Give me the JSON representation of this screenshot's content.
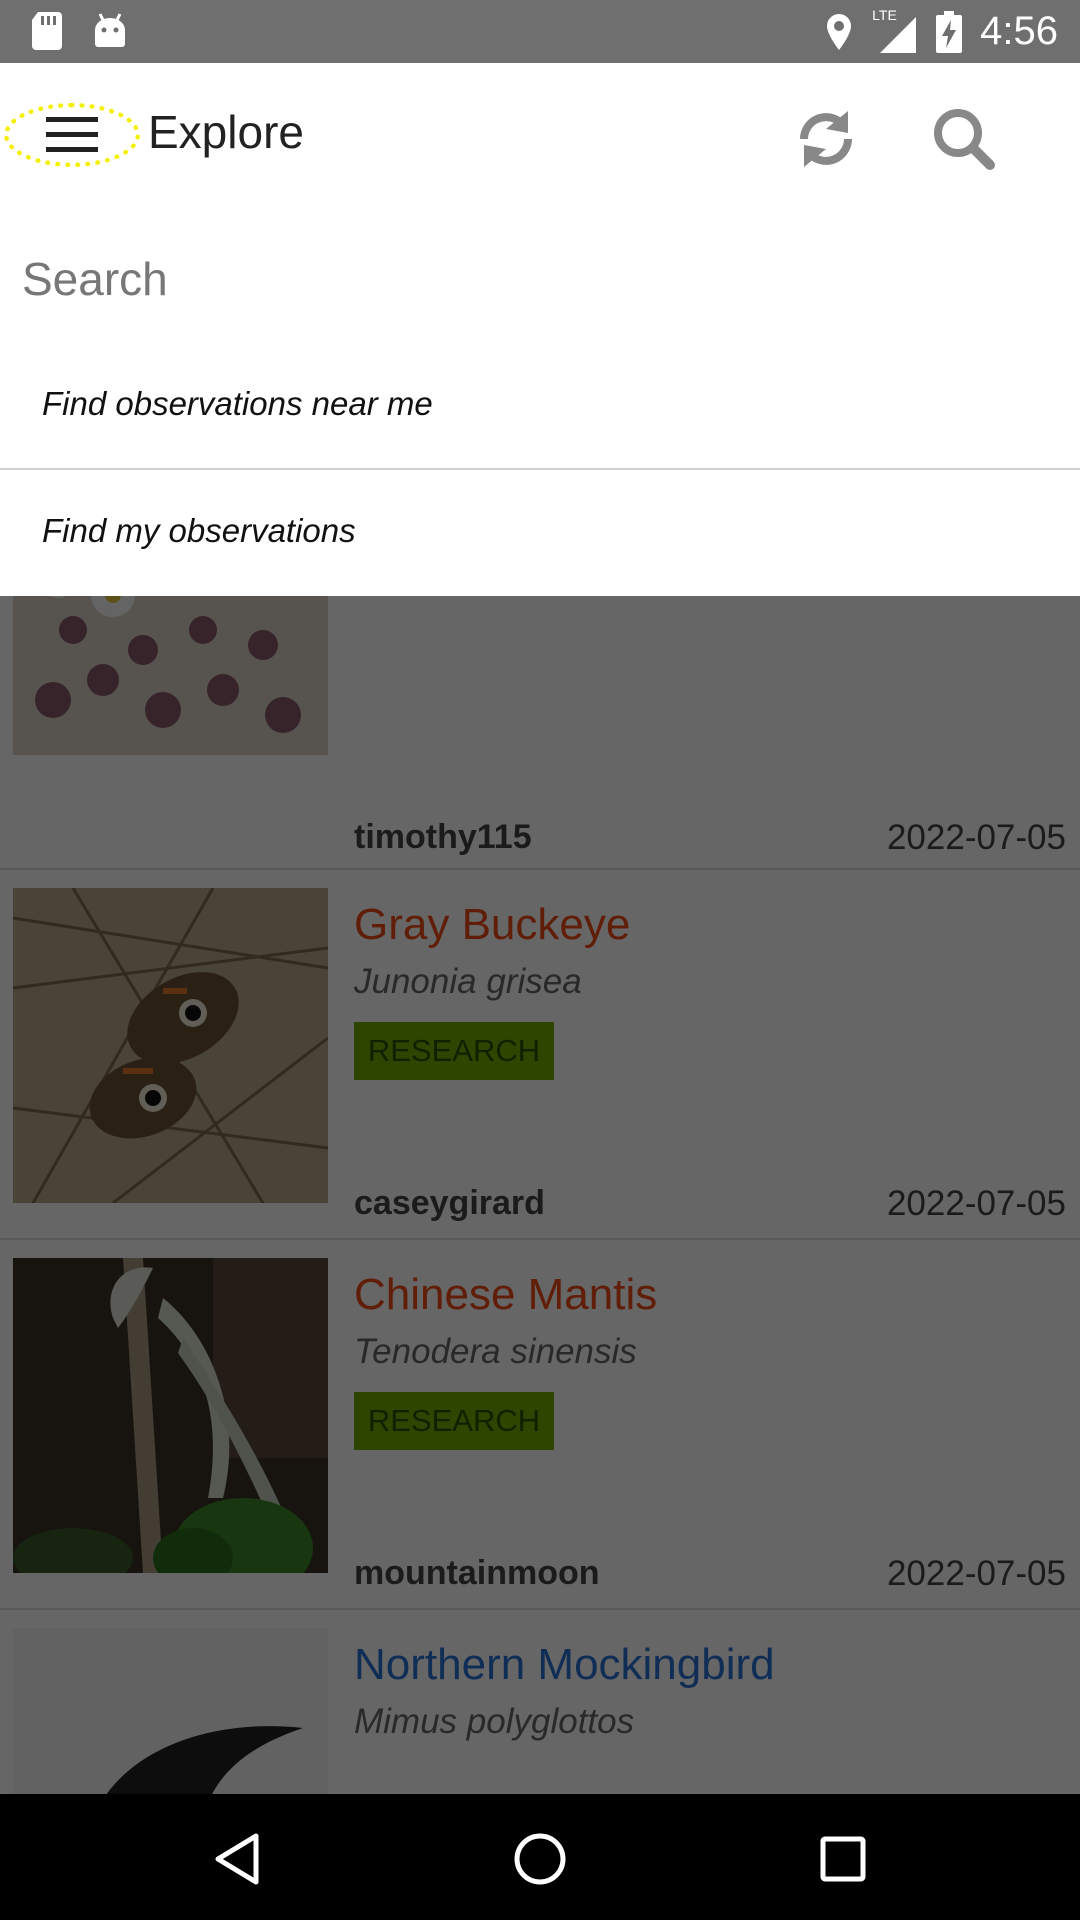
{
  "status_bar": {
    "time": "4:56",
    "network": "LTE"
  },
  "toolbar": {
    "title": "Explore"
  },
  "search": {
    "placeholder": "Search"
  },
  "suggestions": [
    {
      "label": "Find observations near me"
    },
    {
      "label": "Find my observations"
    }
  ],
  "observations": [
    {
      "common_name": "",
      "scientific_name": "",
      "quality": "",
      "user": "timothy115",
      "date": "2022-07-05"
    },
    {
      "common_name": "Gray Buckeye",
      "scientific_name": "Junonia grisea",
      "quality": "RESEARCH",
      "user": "caseygirard",
      "date": "2022-07-05",
      "name_color": "#f04a14"
    },
    {
      "common_name": "Chinese Mantis",
      "scientific_name": "Tenodera sinensis",
      "quality": "RESEARCH",
      "user": "mountainmoon",
      "date": "2022-07-05",
      "name_color": "#f04a14"
    },
    {
      "common_name": "Northern Mockingbird",
      "scientific_name": "Mimus polyglottos",
      "quality": "",
      "user": "",
      "date": "",
      "name_color": "#2a72d4"
    }
  ],
  "colors": {
    "accent": "#74ac00",
    "status_bar": "#6f6f6f",
    "highlight": "#f5f000"
  },
  "icons": {
    "menu": "hamburger-icon",
    "refresh": "refresh-icon",
    "search": "search-icon",
    "nav_back": "back-triangle-icon",
    "nav_home": "home-circle-icon",
    "nav_recents": "recents-square-icon"
  }
}
